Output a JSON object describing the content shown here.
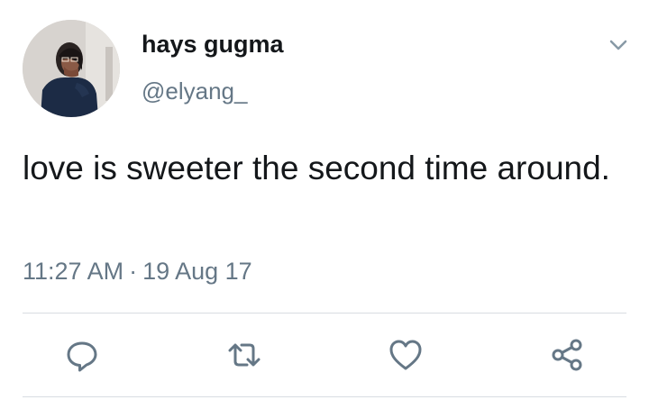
{
  "tweet": {
    "author": {
      "display_name": "hays gugma",
      "handle": "@elyang_"
    },
    "text": "love is sweeter the second time around.",
    "time": "11:27 AM",
    "separator": "·",
    "date": "19 Aug 17"
  },
  "actions": {
    "reply_icon": "reply-icon",
    "retweet_icon": "retweet-icon",
    "like_icon": "heart-icon",
    "share_icon": "share-icon"
  },
  "colors": {
    "text": "#14171a",
    "secondary": "#657786",
    "divider": "#d8dde2",
    "background": "#ffffff"
  }
}
